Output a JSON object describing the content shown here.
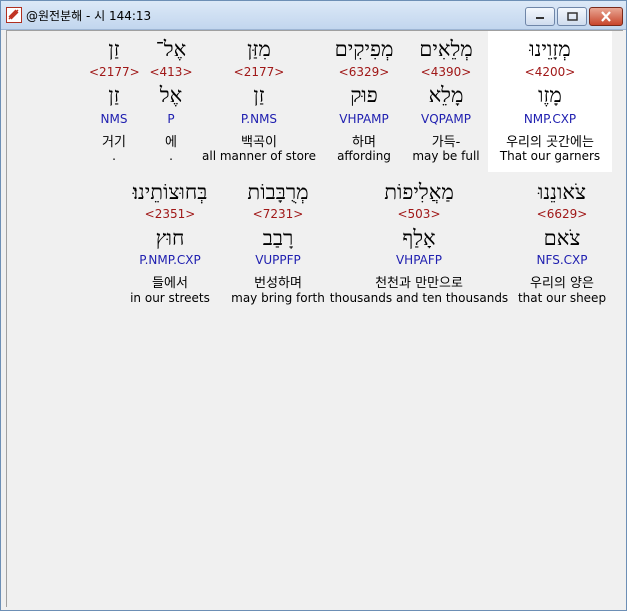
{
  "window": {
    "title": "@원전분해 - 시 144:13",
    "icon": "app-link-icon",
    "accent": "#c8462c"
  },
  "colors": {
    "hebrew": "#000000",
    "strong": "#a01818",
    "morph": "#2020b0",
    "text": "#000000",
    "highlight": "#ffffff"
  },
  "row1": [
    {
      "heb": "מְזָוֵינוּ",
      "strong": "<4200>",
      "lemma": "מָזֶו",
      "morph": "NMP.CXP",
      "kor": "우리의 곳간에는",
      "eng": "That our garners"
    },
    {
      "heb": "מְלֵאִים",
      "strong": "<4390>",
      "lemma": "מָלֵא",
      "morph": "VQPAMP",
      "kor": "가득-",
      "eng": "may be full"
    },
    {
      "heb": "מְפִיקִים",
      "strong": "<6329>",
      "lemma": "פוּק",
      "morph": "VHPAMP",
      "kor": "하며",
      "eng": "affording"
    },
    {
      "heb": "מִזַּן",
      "strong": "<2177>",
      "lemma": "זַן",
      "morph": "P.NMS",
      "kor": "백곡이",
      "eng": "all manner of store"
    },
    {
      "heb": "אֶל־",
      "strong": "<413>",
      "lemma": "אֶל",
      "morph": "P",
      "kor": "에",
      "eng": "."
    },
    {
      "heb": "זַן",
      "strong": "<2177>",
      "lemma": "זַן",
      "morph": "NMS",
      "kor": "거기",
      "eng": "."
    }
  ],
  "row2": [
    {
      "heb": "צֹאונֵנוּ",
      "strong": "<6629>",
      "lemma": "צֹאם",
      "morph": "NFS.CXP",
      "kor": "우리의 양은",
      "eng": "that our sheep"
    },
    {
      "heb": "מַאֲלִיפוֹת",
      "strong": "<503>",
      "lemma": "אָלַף",
      "morph": "VHPAFP",
      "kor": "천천과 만만으로",
      "eng": "thousands and ten thousands"
    },
    {
      "heb": "מְרֻבָּבוֹת",
      "strong": "<7231>",
      "lemma": "רָבַב",
      "morph": "VUPPFP",
      "kor": "번성하며",
      "eng": "may bring forth"
    },
    {
      "heb": "בְּחוּצוֹתֵינוּ׃",
      "strong": "<2351>",
      "lemma": "חוּץ",
      "morph": "P.NMP.CXP",
      "kor": "들에서",
      "eng": "in our streets"
    }
  ]
}
